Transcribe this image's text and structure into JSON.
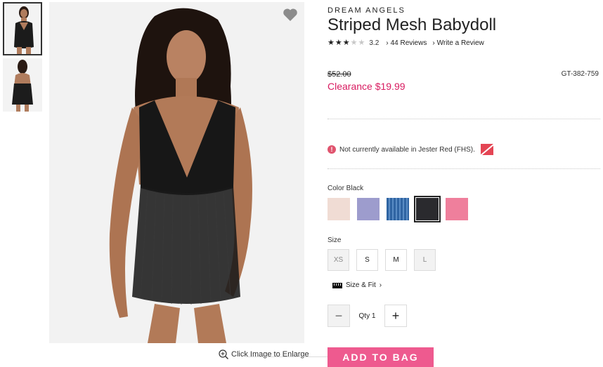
{
  "product": {
    "brand": "DREAM ANGELS",
    "title": "Striped Mesh Babydoll",
    "rating": 3.2,
    "rating_text": "3.2",
    "reviews_link": "44 Reviews",
    "write_review_link": "Write a Review",
    "was_price": "$52.00",
    "sale_price": "Clearance $19.99",
    "sku": "GT-382-759"
  },
  "availability": {
    "message": "Not currently available in Jester Red (FHS).",
    "swatch_color": "#e44554"
  },
  "color": {
    "label": "Color Black",
    "swatches": [
      {
        "name": "blush",
        "color": "#f0dcd4",
        "selected": false
      },
      {
        "name": "lavender",
        "color": "#9d9ccd",
        "selected": false
      },
      {
        "name": "blue-stripe",
        "color": "#3d73b0",
        "selected": false
      },
      {
        "name": "black",
        "color": "#2a2a2e",
        "selected": true
      },
      {
        "name": "pink",
        "color": "#ef7f9c",
        "selected": false
      }
    ]
  },
  "size": {
    "label": "Size",
    "options": [
      {
        "label": "XS",
        "available": false
      },
      {
        "label": "S",
        "available": true
      },
      {
        "label": "M",
        "available": true
      },
      {
        "label": "L",
        "available": false
      }
    ],
    "size_fit_link": "Size & Fit"
  },
  "quantity": {
    "label": "Qty",
    "value": "1",
    "minus": "−",
    "plus": "+"
  },
  "cta": {
    "add_to_bag": "ADD TO BAG"
  },
  "gallery": {
    "enlarge_text": "Click Image to Enlarge"
  },
  "colors": {
    "accent_pink": "#ee5a8f",
    "sale_red": "#d81b60"
  }
}
